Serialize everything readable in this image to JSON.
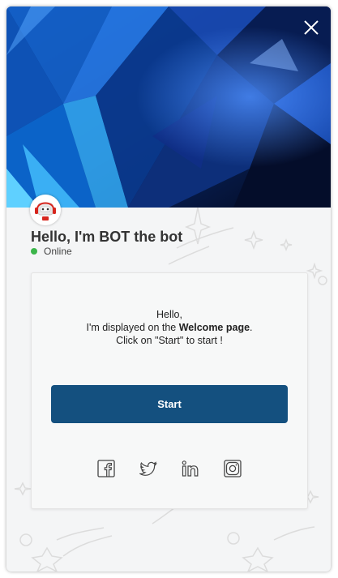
{
  "bot": {
    "name": "Hello, I'm BOT the bot",
    "status": "Online",
    "avatar_icon": "robot-headset-icon",
    "status_color": "#3bb54a"
  },
  "welcome": {
    "line1": "Hello,",
    "line2_prefix": "I'm displayed on the ",
    "line2_bold": "Welcome page",
    "line2_suffix": ".",
    "line3": "Click on \"Start\" to start !"
  },
  "start_button": {
    "label": "Start",
    "color": "#14507f"
  },
  "social_icons": [
    "facebook-icon",
    "twitter-icon",
    "linkedin-icon",
    "instagram-icon"
  ],
  "hero": {
    "theme": "blue crystal abstract",
    "close_icon": "close-icon"
  }
}
